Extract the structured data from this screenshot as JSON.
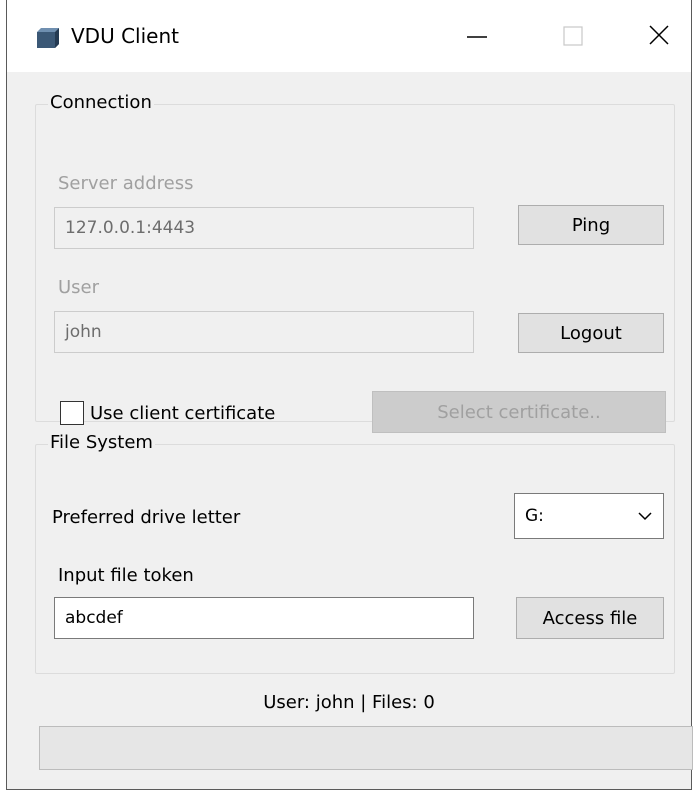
{
  "window": {
    "title": "VDU Client"
  },
  "connection": {
    "group_label": "Connection",
    "server_label": "Server address",
    "server_value": "127.0.0.1:4443",
    "ping_label": "Ping",
    "user_label": "User",
    "user_value": "john",
    "logout_label": "Logout",
    "use_cert_label": "Use client certificate",
    "use_cert_checked": false,
    "select_cert_label": "Select certificate.."
  },
  "file_system": {
    "group_label": "File System",
    "drive_label": "Preferred drive letter",
    "drive_value": "G:",
    "token_label": "Input file token",
    "token_value": "abcdef",
    "access_label": "Access file"
  },
  "status": {
    "text": "User: john | Files: 0",
    "progress": 0
  }
}
